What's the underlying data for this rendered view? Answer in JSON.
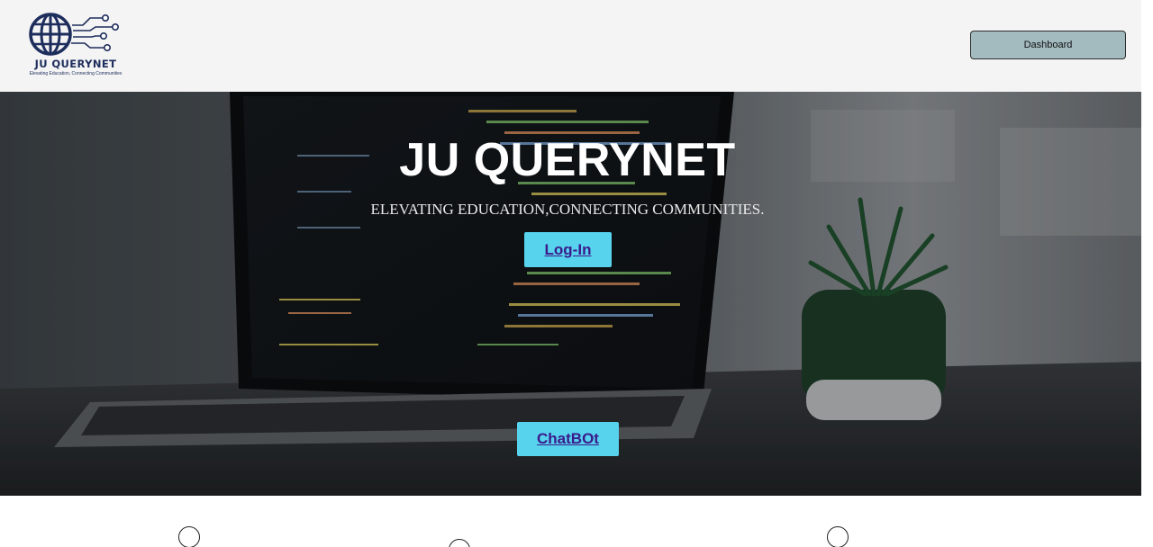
{
  "header": {
    "logo": {
      "icon": "globe-circuit-icon",
      "title": "JU QUERYNET",
      "tagline": "Elevating Education, Connecting Communities"
    },
    "dashboard_label": "Dashboard"
  },
  "hero": {
    "title": "JU QUERYNET",
    "subtitle": "ELEVATING EDUCATION,CONNECTING COMMUNITIES.",
    "login_label": "Log-In",
    "chatbot_label": "ChatBOt"
  },
  "features": {
    "icons": [
      "circle-icon",
      "circle-icon",
      "circle-icon"
    ]
  },
  "colors": {
    "header_bg": "#f4f4f4",
    "dashboard_bg": "#a3babf",
    "button_cyan": "#57d3ee",
    "button_text": "#3a1a8a",
    "logo_navy": "#1d2d5c"
  }
}
